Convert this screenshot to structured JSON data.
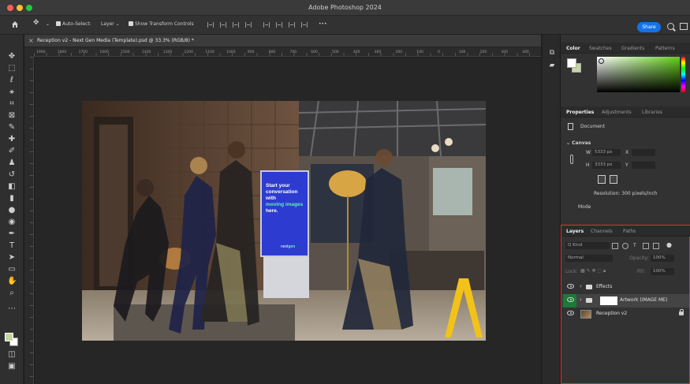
{
  "window": {
    "title": "Adobe Photoshop 2024"
  },
  "options_bar": {
    "auto_select_label": "Auto-Select:",
    "auto_select_value": "Layer",
    "show_transform_label": "Show Transform Controls",
    "more_label": "•••",
    "share_label": "Share"
  },
  "document": {
    "tab_title": "Reception v2 - Next Gen Media (Template).psd @ 33.3% (RGB/8) *",
    "ruler_ticks": [
      "1900",
      "1800",
      "1700",
      "1600",
      "1500",
      "1400",
      "1300",
      "1200",
      "1100",
      "1000",
      "900",
      "800",
      "700",
      "600",
      "500",
      "400",
      "300",
      "200",
      "100",
      "0",
      "100",
      "200",
      "300",
      "400"
    ]
  },
  "poster": {
    "line1": "Start your",
    "line2": "conversation",
    "line3": "with",
    "highlight": "moving images",
    "line5": "here.",
    "logo_main": "next",
    "logo_accent": "gen"
  },
  "color_panel": {
    "tabs": [
      "Color",
      "Swatches",
      "Gradients",
      "Patterns"
    ],
    "foreground": "#ffffff",
    "background": "#c6d5a0",
    "accent": "#63cf1a"
  },
  "properties_panel": {
    "tabs": [
      "Properties",
      "Adjustments",
      "Libraries"
    ],
    "type_label": "Document",
    "canvas_label": "Canvas",
    "width_label": "W",
    "width_value": "5333 px",
    "height_label": "H",
    "height_value": "3333 px",
    "x_label": "X",
    "y_label": "Y",
    "resolution": "Resolution: 300 pixels/inch",
    "mode_label": "Mode"
  },
  "layers_panel": {
    "tabs": [
      "Layers",
      "Channels",
      "Paths"
    ],
    "filter_value": "Q Kind",
    "blend_mode": "Normal",
    "opacity_label": "Opacity:",
    "opacity_value": "100%",
    "lock_label": "Lock:",
    "fill_label": "Fill:",
    "fill_value": "100%",
    "layers": [
      {
        "name": "Effects"
      },
      {
        "name": "Artwork (IMAGE ME)"
      },
      {
        "name": "Reception v2"
      }
    ]
  }
}
